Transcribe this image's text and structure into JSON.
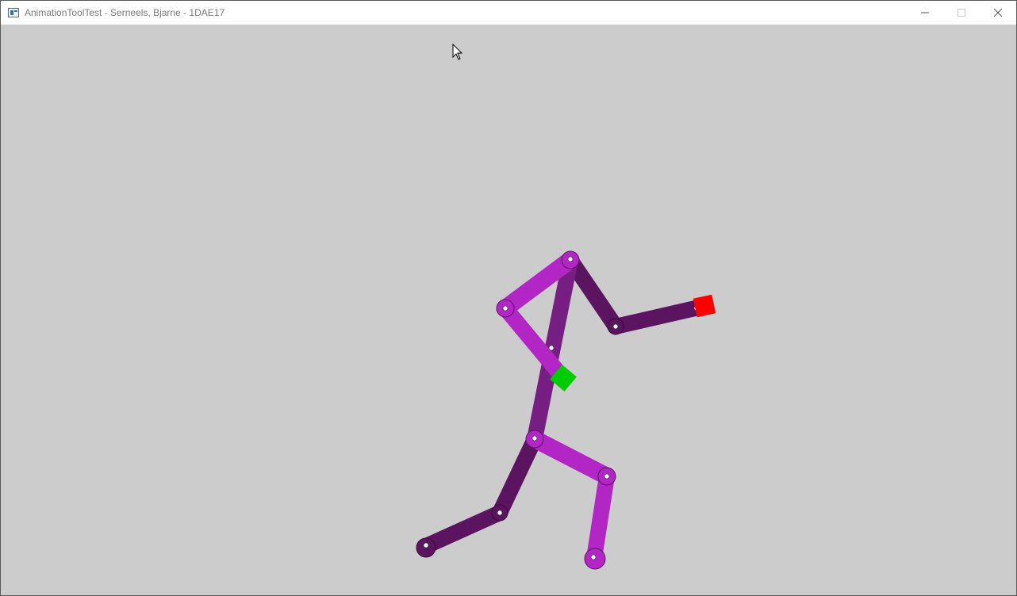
{
  "window": {
    "title": "AnimationToolTest - Serneels, Bjarne - 1DAE17",
    "controls": {
      "minimize": "minimize-icon",
      "maximize": "maximize-icon",
      "close": "close-icon"
    }
  },
  "scene": {
    "background_color": "#cccccc",
    "colors": {
      "bone_front": "#b126c4",
      "bone_back": "#5b1460",
      "torso": "#761e82",
      "handle_selected": "#00cc00",
      "handle_target": "#ff0000"
    }
  }
}
